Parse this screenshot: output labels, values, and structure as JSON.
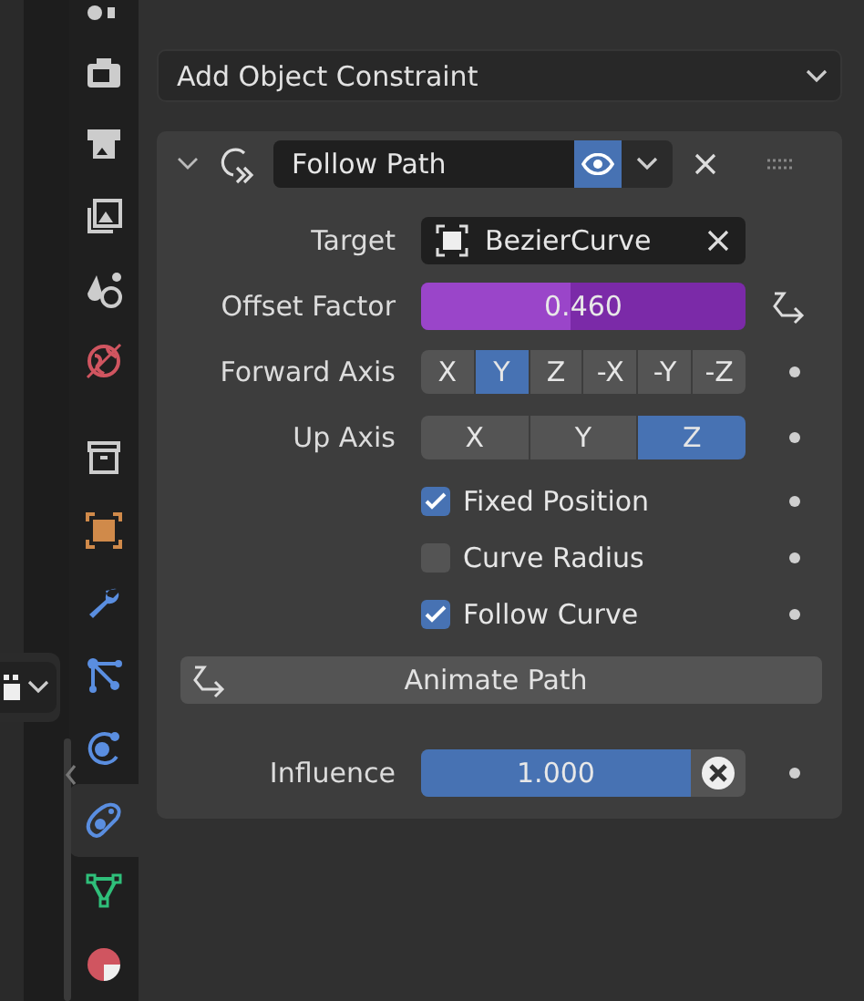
{
  "tabs": [
    {
      "kind": "tool",
      "selected": false
    },
    {
      "kind": "render",
      "selected": false
    },
    {
      "kind": "output",
      "selected": false
    },
    {
      "kind": "view-layer",
      "selected": false
    },
    {
      "kind": "scene",
      "selected": false
    },
    {
      "kind": "world",
      "selected": false
    },
    {
      "kind": "collection",
      "selected": false
    },
    {
      "kind": "object",
      "selected": false
    },
    {
      "kind": "modifier",
      "selected": false
    },
    {
      "kind": "particles",
      "selected": false
    },
    {
      "kind": "physics",
      "selected": false
    },
    {
      "kind": "constraint",
      "selected": true
    },
    {
      "kind": "data",
      "selected": false
    },
    {
      "kind": "material",
      "selected": false
    }
  ],
  "add_menu": {
    "label": "Add Object Constraint"
  },
  "constraint": {
    "name": "Follow Path",
    "expanded": true,
    "enabled": true,
    "target": {
      "label": "Target",
      "value": "BezierCurve"
    },
    "offset": {
      "label": "Offset Factor",
      "value": "0.460",
      "level": 0.46
    },
    "forward_axis": {
      "label": "Forward Axis",
      "options": [
        {
          "label": "X",
          "selected": false
        },
        {
          "label": "Y",
          "selected": true
        },
        {
          "label": "Z",
          "selected": false
        },
        {
          "label": "-X",
          "selected": false
        },
        {
          "label": "-Y",
          "selected": false
        },
        {
          "label": "-Z",
          "selected": false
        }
      ]
    },
    "up_axis": {
      "label": "Up Axis",
      "options": [
        {
          "label": "X",
          "selected": false
        },
        {
          "label": "Y",
          "selected": false
        },
        {
          "label": "Z",
          "selected": true
        }
      ]
    },
    "checkboxes": [
      {
        "label": "Fixed Position",
        "checked": true
      },
      {
        "label": "Curve Radius",
        "checked": false
      },
      {
        "label": "Follow Curve",
        "checked": true
      }
    ],
    "animate_button": {
      "label": "Animate Path"
    },
    "influence": {
      "label": "Influence",
      "value": "1.000",
      "level": 1
    }
  }
}
